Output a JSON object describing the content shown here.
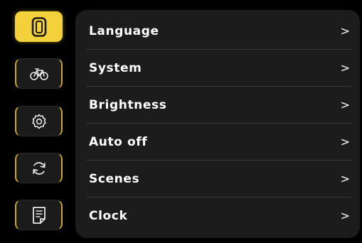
{
  "sidebar": {
    "items": [
      {
        "name": "device",
        "icon": "device-icon",
        "active": true
      },
      {
        "name": "bike",
        "icon": "bicycle-icon",
        "active": false
      },
      {
        "name": "settings",
        "icon": "gear-icon",
        "active": false
      },
      {
        "name": "sync",
        "icon": "sync-icon",
        "active": false
      },
      {
        "name": "notes",
        "icon": "document-icon",
        "active": false
      }
    ]
  },
  "menu": {
    "items": [
      {
        "label": "Language",
        "chevron": ">"
      },
      {
        "label": "System",
        "chevron": ">"
      },
      {
        "label": "Brightness",
        "chevron": ">"
      },
      {
        "label": "Auto off",
        "chevron": ">"
      },
      {
        "label": "Scenes",
        "chevron": ">"
      },
      {
        "label": "Clock",
        "chevron": ">"
      }
    ]
  },
  "colors": {
    "accent": "#f3d13a",
    "panel": "#1c1c1c",
    "background": "#000000",
    "text": "#ffffff"
  }
}
